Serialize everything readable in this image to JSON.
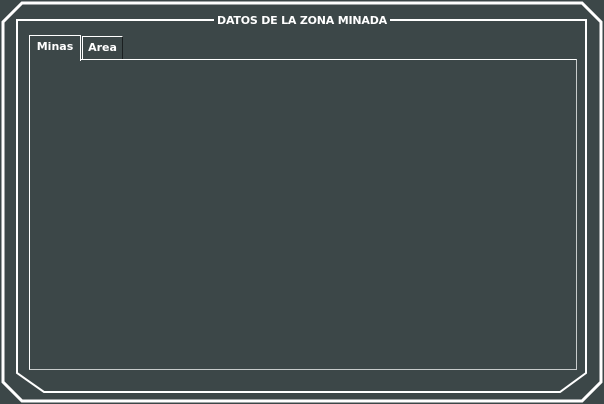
{
  "panel": {
    "title": "DATOS DE LA ZONA MINADA"
  },
  "tabs": [
    {
      "label": "Minas",
      "selected": true
    },
    {
      "label": "Area",
      "selected": false
    }
  ],
  "colors": {
    "background": "#3c4748",
    "border": "#ffffff",
    "text": "#ffffff"
  }
}
